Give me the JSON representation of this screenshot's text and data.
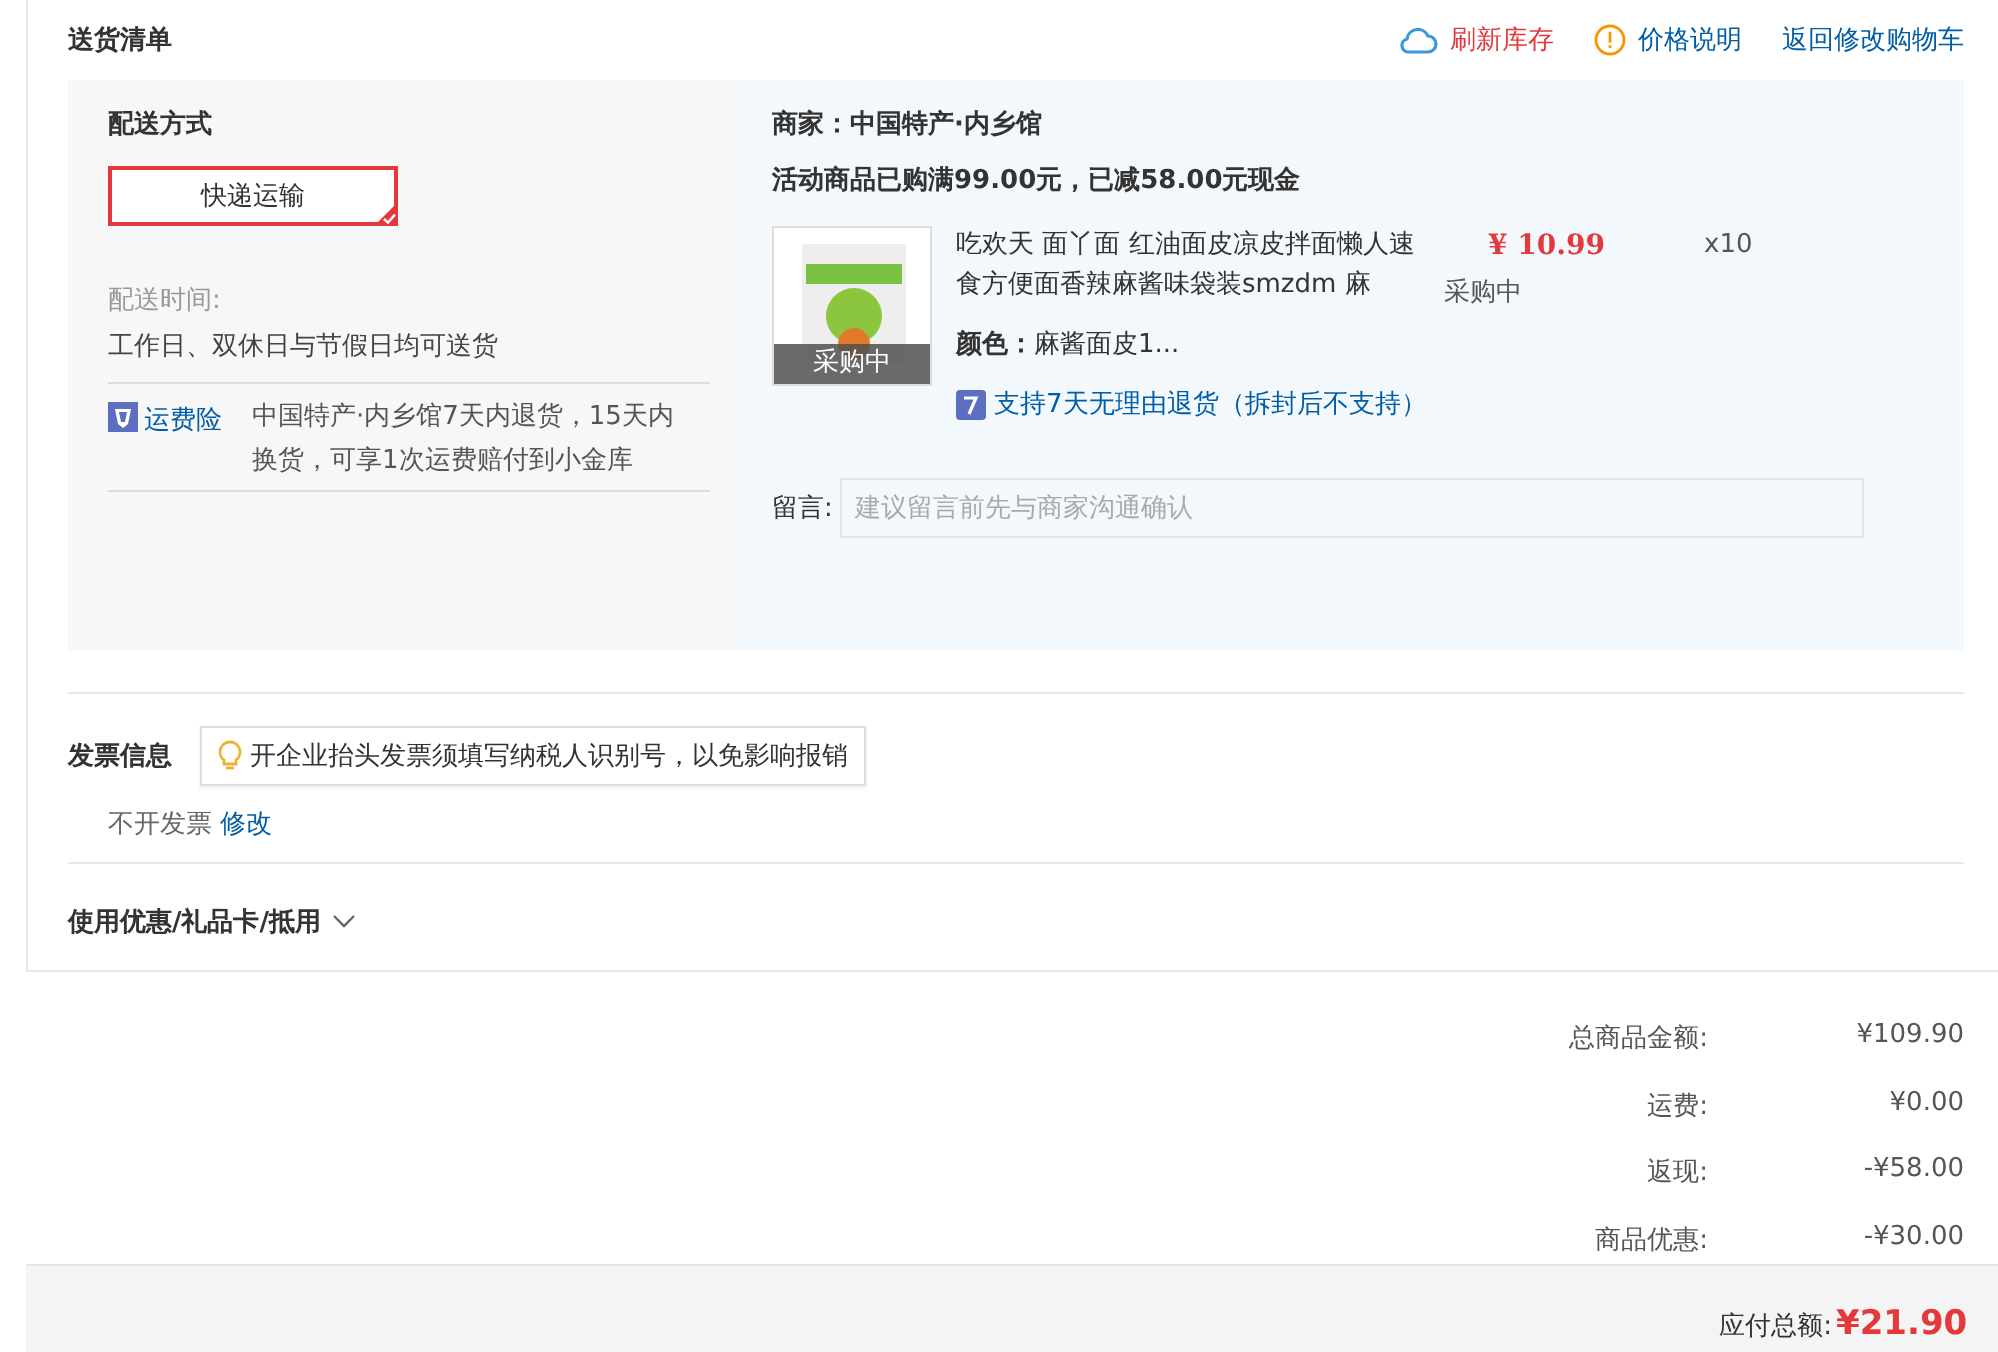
{
  "section_title": "送货清单",
  "header_links": [
    {
      "kind": "refresh",
      "label": "刷新库存"
    },
    {
      "kind": "info",
      "label": "价格说明"
    },
    {
      "kind": "plain",
      "label": "返回修改购物车"
    }
  ],
  "delivery": {
    "title": "配送方式",
    "options": [
      {
        "label": "快递运输",
        "selected": true
      }
    ],
    "time_label": "配送时间:",
    "time_value": "工作日、双休日与节假日均可送货",
    "insurance_label": "运费险",
    "insurance_text": "中国特产·内乡馆7天内退货，15天内换货，可享1次运费赔付到小金库"
  },
  "shop": {
    "merchant": "商家：中国特产·内乡馆",
    "promo": "活动商品已购满99.00元，已减58.00元现金",
    "item": {
      "image_badge": "采购中",
      "title": "吃欢天 面丫面 红油面皮凉皮拌面懒人速食方便面香辣麻酱味袋装smzdm 麻",
      "color_label": "颜色：",
      "color_value": "麻酱面皮1...",
      "returns": "支持7天无理由退货（拆封后不支持）",
      "price": "¥ 10.99",
      "status": "采购中",
      "quantity": "x10"
    },
    "message_label": "留言:",
    "message_placeholder": "建议留言前先与商家沟通确认"
  },
  "invoice": {
    "title": "发票信息",
    "tip": "开企业抬头发票须填写纳税人识别号，以免影响报销",
    "value": "不开发票",
    "edit_link": "修改"
  },
  "coupons": {
    "label": "使用优惠/礼品卡/抵用",
    "expanded": false
  },
  "totals": [
    {
      "label": "总商品金额:",
      "value": "¥109.90"
    },
    {
      "label": "运费:",
      "value": "¥0.00"
    },
    {
      "label": "返现:",
      "value": "-¥58.00"
    },
    {
      "label": "商品优惠:",
      "value": "-¥30.00"
    }
  ],
  "payable": {
    "label": "应付总额:",
    "value": "¥21.90"
  }
}
